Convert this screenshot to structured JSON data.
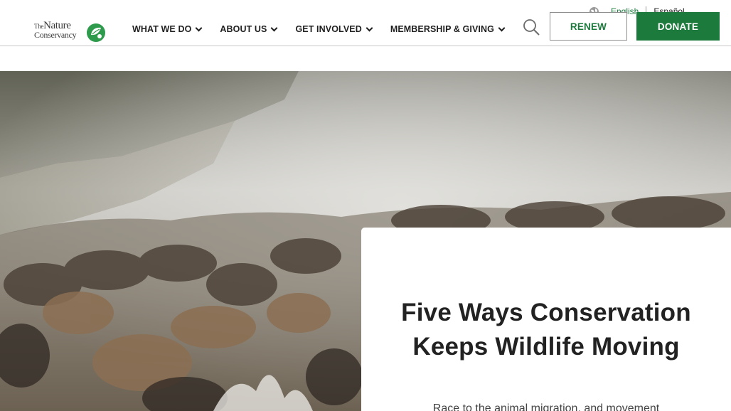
{
  "header": {
    "logo": {
      "line1": "The",
      "line2": "Nature",
      "line3": "Conservancy"
    },
    "nav": [
      {
        "label": "WHAT WE DO"
      },
      {
        "label": "ABOUT US"
      },
      {
        "label": "GET INVOLVED"
      },
      {
        "label": "MEMBERSHIP & GIVING"
      }
    ],
    "search_icon": "search-icon",
    "language": {
      "icon": "globe-icon",
      "current": "English",
      "alternate": "Español"
    },
    "renew_label": "RENEW",
    "donate_label": "DONATE",
    "colors": {
      "brand_green": "#1b7a3c",
      "text": "#1f1f1f"
    }
  },
  "hero": {
    "image": "wildebeest-migration-river-crossing",
    "card": {
      "title": "Five Ways Conservation Keeps Wildlife Moving",
      "subtitle": "Race to the animal migration, and movement"
    }
  }
}
